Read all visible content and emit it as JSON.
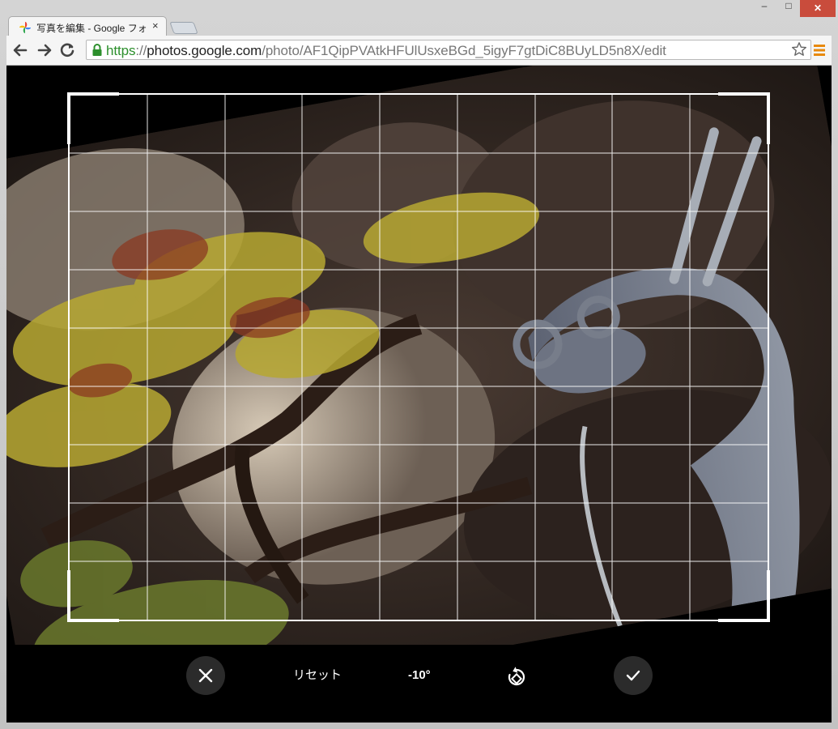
{
  "browser": {
    "tab_title": "写真を編集 - Google フォト",
    "tab_close": "×",
    "window_controls": {
      "minimize": "‒",
      "maximize": "□",
      "close": "✕"
    },
    "url": {
      "scheme": "https",
      "separator": "://",
      "host": "photos.google.com",
      "path": "/photo/AF1QipPVAtkHFUlUsxeBGd_5igyF7gtDiC8BUyLD5n8X/edit"
    }
  },
  "editor": {
    "cancel_icon": "close-icon",
    "reset_label": "リセット",
    "rotation_angle": "-10°",
    "rotate_icon": "rotate-icon",
    "confirm_icon": "check-icon",
    "grid": {
      "columns": 9,
      "rows": 9
    },
    "rotation_degrees": -10
  },
  "colors": {
    "chrome_bg": "#c6c6c6",
    "close_button": "#c94c3c",
    "url_secure": "#2c8f2c",
    "menu_icon": "#e8890c",
    "editor_bg": "#000000",
    "button_bg": "#2b2b2b"
  }
}
